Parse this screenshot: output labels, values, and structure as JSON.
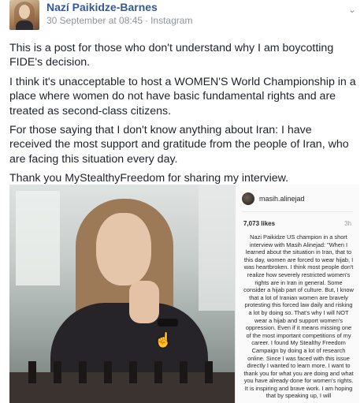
{
  "post": {
    "author": "Nazí Paikidze-Barnes",
    "timestamp": "30 September at 08:45",
    "separator": "·",
    "source": "Instagram",
    "dropdown_icon": "chevron-down-icon",
    "paragraphs": [
      "This is a post for those who don't understand why I am boycotting FIDE's decision.",
      "I think it's unacceptable to host a WOMEN'S World Championship in a place where women do not have basic fundamental rights and are treated as second-class citizens.",
      "For those saying that I don't know anything about Iran: I have received the most support and gratitude from the people of Iran, who are facing this situation every day.",
      "Thank you MyStealthyFreedom for sharing my interview."
    ]
  },
  "instagram": {
    "username": "masih.alinejad",
    "likes": "7,073 likes",
    "time": "3h",
    "caption": "Nazi Paikidze US champion in a short interview with Masih Alinejad: \"When I learned about the situation in Iran, that to this day, women are forced to wear hijab, I was heartbroken. I think most people don't realize how severely restricted women's rights are in Iran in general. Some consider a hijab part of culture. But, I know that a lot of Iranian women are bravely protesting this forced law daily and risking a lot by doing so. That's why I will NOT wear a hijab and support women's oppression. Even if it means missing one of the most important competitions of my career. I found My Stealthy Freedom Campaign by doing a lot of research online. Since I was faced with this issue directly I wanted to learn more. I want to thank you for what you are doing and what you have already done for women's rights. It is inspiring and brave work. I am hoping that by speaking up, I will"
  },
  "icons": {
    "cursor": "hand-pointer-icon"
  }
}
